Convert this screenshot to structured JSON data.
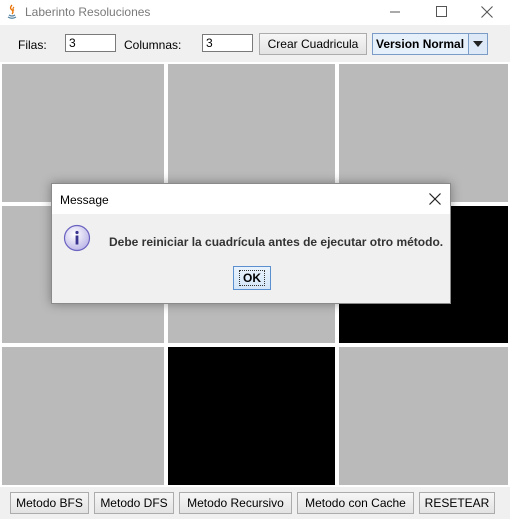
{
  "window": {
    "title": "Laberinto Resoluciones",
    "icons": [
      "java-icon",
      "minimize-icon",
      "maximize-icon",
      "close-icon"
    ]
  },
  "toolbar": {
    "filas_label": "Filas:",
    "filas_value": "3",
    "columnas_label": "Columnas:",
    "columnas_value": "3",
    "crear_label": "Crear Cuadricula",
    "version_selected": "Version Normal"
  },
  "grid": {
    "rows": 3,
    "cols": 3,
    "cells": [
      [
        "empty",
        "empty",
        "empty"
      ],
      [
        "empty",
        "empty",
        "wall"
      ],
      [
        "empty",
        "wall",
        "empty"
      ]
    ],
    "colors": {
      "empty": "#bababa",
      "wall": "#000000"
    }
  },
  "bottom": {
    "bfs_label": "Metodo BFS",
    "dfs_label": "Metodo DFS",
    "recursivo_label": "Metodo Recursivo",
    "cache_label": "Metodo con Cache",
    "resetear_label": "RESETEAR"
  },
  "dialog": {
    "title": "Message",
    "message": "Debe reiniciar la cuadrícula antes de ejecutar otro método.",
    "ok_label": "OK",
    "icon": "info-icon"
  }
}
